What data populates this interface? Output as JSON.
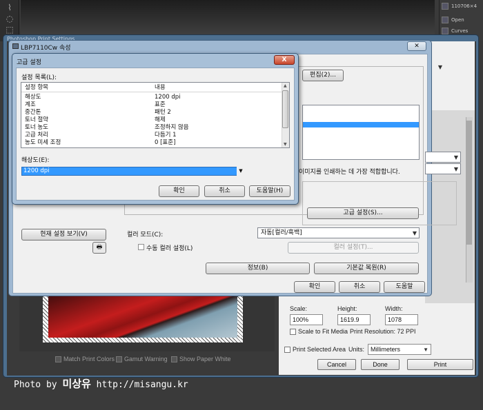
{
  "photoshop": {
    "panel_items": [
      "110706×4",
      "Open",
      "Curves"
    ],
    "tool_icons": [
      "lasso-icon",
      "marquee-icon"
    ]
  },
  "print_settings": {
    "title": "Photoshop Print Settings",
    "scale_label": "Scale:",
    "height_label": "Height:",
    "width_label": "Width:",
    "scale_value": "100%",
    "height_value": "1619.9",
    "width_value": "1078",
    "scale_to_fit_label": "Scale to Fit Media",
    "print_resolution": "Print Resolution: 72 PPI",
    "print_selected_area_label": "Print Selected Area",
    "units_label": "Units:",
    "units_value": "Millimeters",
    "cancel_label": "Cancel",
    "done_label": "Done",
    "print_label": "Print",
    "match_print_colors": "Match Print Colors",
    "gamut_warning": "Gamut Warning",
    "show_paper_white": "Show Paper White"
  },
  "lbp_dialog": {
    "title": "LBP7110Cw 속성",
    "edit_button": "편집(2)...",
    "description_text": "이미지를 인쇄하는 데 가장 적합합니다.",
    "advanced_button": "고급 설정(S)...",
    "view_current_settings": "현재 설정 보기(V)",
    "color_mode_label": "컬러 모드(C):",
    "color_mode_value": "자동[컬러/흑백]",
    "manual_color_label": "수동 컬러 설정(L)",
    "color_settings_button": "컬러 설정(T)...",
    "info_button": "정보(B)",
    "restore_defaults_button": "기본값 복원(R)",
    "ok_button": "확인",
    "cancel_button": "취소",
    "help_button": "도움말"
  },
  "advanced_dialog": {
    "title": "고급 설정",
    "list_label": "설정 목록(L):",
    "col_item": "설정 항목",
    "col_value": "내용",
    "rows": [
      {
        "item": "해상도",
        "value": "1200 dpi"
      },
      {
        "item": "계조",
        "value": "표준"
      },
      {
        "item": "중간톤",
        "value": "패턴 2"
      },
      {
        "item": "토너 절약",
        "value": "해제"
      },
      {
        "item": "토너 농도",
        "value": "조정하지 않음"
      },
      {
        "item": "고급 처리",
        "value": "다듬기 1"
      },
      {
        "item": "농도 미세 조정",
        "value": "0 [표준]"
      }
    ],
    "resolution_label": "해상도(E):",
    "resolution_value": "1200 dpi",
    "ok_button": "확인",
    "cancel_button": "취소",
    "help_button": "도움말(H)",
    "close_symbol": "X"
  },
  "watermark": {
    "prefix": "Photo by ",
    "name": "미상유",
    "url": " http://misangu.kr"
  }
}
